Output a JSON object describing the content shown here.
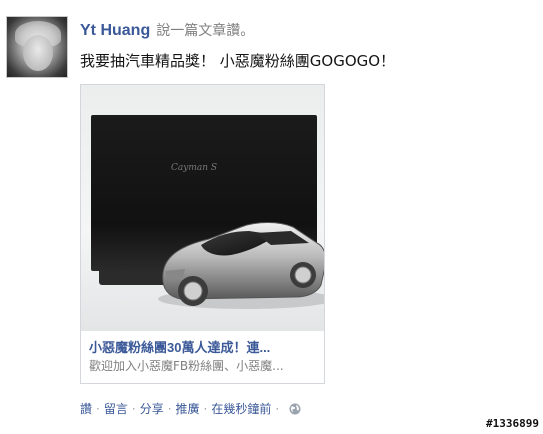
{
  "post": {
    "author": "Yt Huang",
    "action": "說一篇文章讚。",
    "message": "我要抽汽車精品獎！ 小惡魔粉絲團GOGOGO！"
  },
  "card": {
    "box_logo": "Cayman S",
    "title": "小惡魔粉絲團30萬人達成！連...",
    "description": "歡迎加入小惡魔FB粉絲團、小惡魔..."
  },
  "footer": {
    "like": "讚",
    "comment": "留言",
    "share": "分享",
    "promote": "推廣",
    "timestamp": "在幾秒鐘前",
    "separator": "·",
    "privacy_icon": "globe-icon"
  },
  "watermark": "#1336899"
}
